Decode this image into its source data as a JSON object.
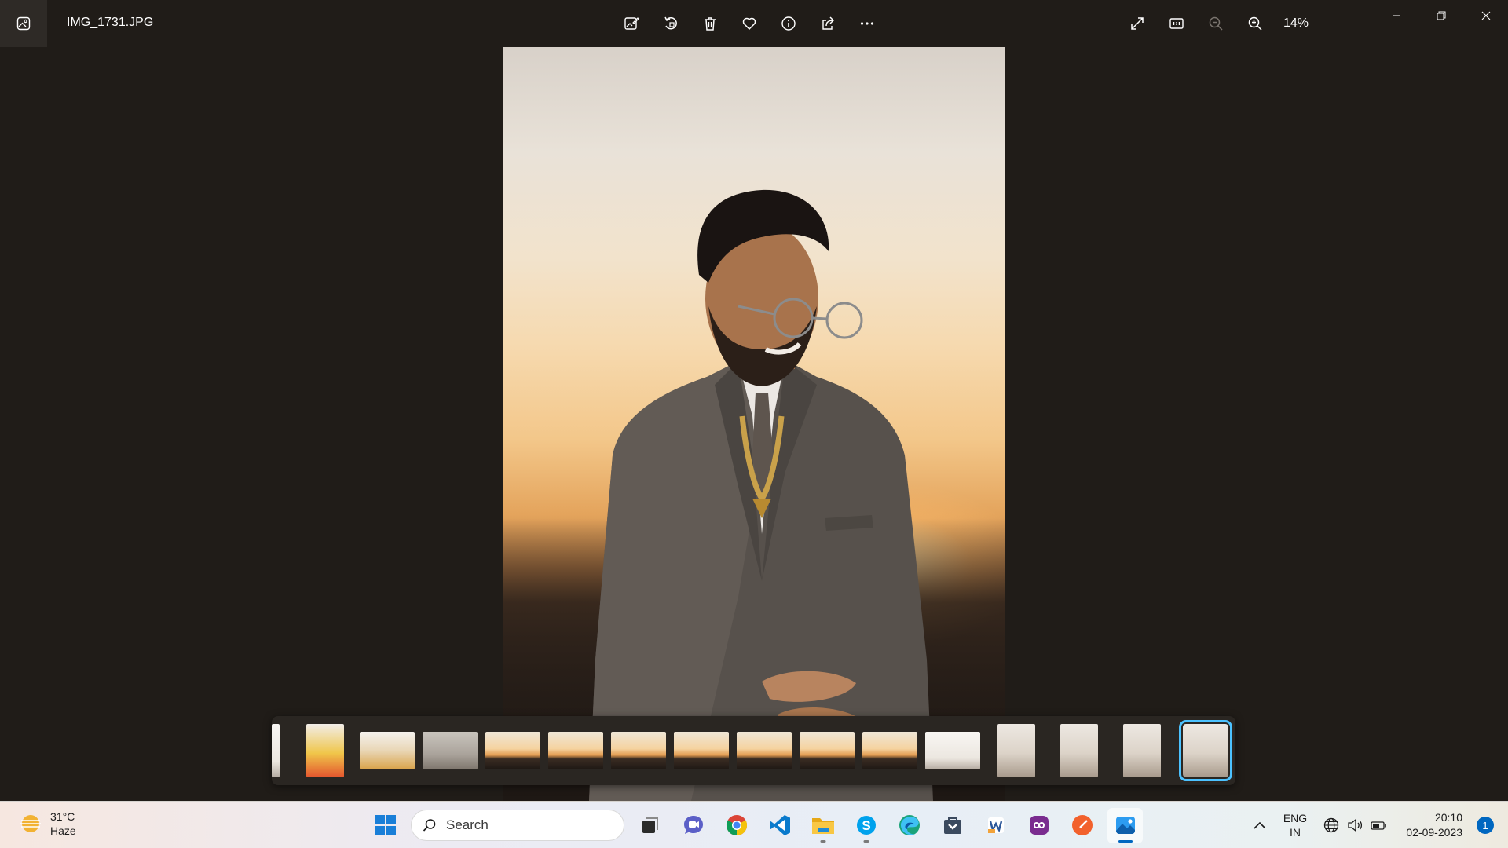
{
  "window": {
    "file_name": "IMG_1731.JPG",
    "zoom_level": "14%"
  },
  "toolbar": {
    "buttons": [
      "edit-image",
      "rotate",
      "delete",
      "favorite",
      "file-info",
      "share",
      "more-options"
    ]
  },
  "view_controls": [
    "fullscreen",
    "actual-size",
    "zoom-out",
    "zoom-in"
  ],
  "filmstrip": {
    "selected_index": 15,
    "thumbnails": [
      {
        "kind": "portrait",
        "subject": "partial"
      },
      {
        "kind": "portrait",
        "subject": "group"
      },
      {
        "kind": "landscape",
        "subject": "group"
      },
      {
        "kind": "landscape",
        "subject": "person"
      },
      {
        "kind": "landscape",
        "subject": "sunset"
      },
      {
        "kind": "landscape",
        "subject": "sunset"
      },
      {
        "kind": "landscape",
        "subject": "sunset"
      },
      {
        "kind": "landscape",
        "subject": "sunset"
      },
      {
        "kind": "landscape",
        "subject": "sunset"
      },
      {
        "kind": "landscape",
        "subject": "sunset"
      },
      {
        "kind": "landscape",
        "subject": "sunset"
      },
      {
        "kind": "landscape",
        "subject": "white"
      },
      {
        "kind": "portrait",
        "subject": "suit"
      },
      {
        "kind": "portrait",
        "subject": "suit"
      },
      {
        "kind": "portrait",
        "subject": "suit"
      },
      {
        "kind": "portrait",
        "subject": "suit"
      }
    ]
  },
  "taskbar": {
    "weather": {
      "temperature": "31°C",
      "condition": "Haze"
    },
    "search_placeholder": "Search",
    "apps": [
      "start",
      "search",
      "task-view",
      "teams",
      "chrome",
      "vscode",
      "file-explorer",
      "skype",
      "edge",
      "app-store",
      "word",
      "media-app",
      "other-app",
      "photos"
    ],
    "language": {
      "line1": "ENG",
      "line2": "IN"
    },
    "time": "20:10",
    "date": "02-09-2023",
    "notification_count": "1"
  }
}
